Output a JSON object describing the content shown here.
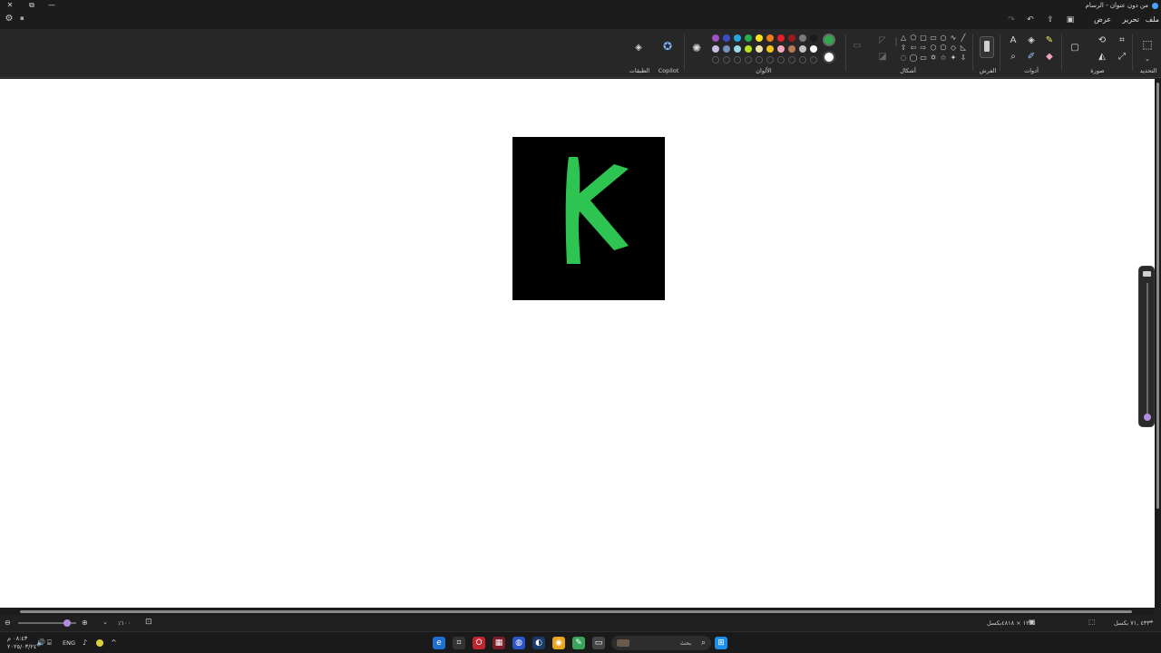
{
  "window": {
    "title": "من دون عنوان - الرسام",
    "min": "—",
    "restore": "⧉",
    "close": "✕"
  },
  "menu": {
    "file": "ملف",
    "edit": "تحرير",
    "view": "عرض"
  },
  "ribbon": {
    "groups": {
      "selection": "التحديد",
      "image": "صورة",
      "tools": "أدوات",
      "brushes": "الفرش",
      "shapes": "أشكال",
      "colors": "الألوان",
      "copilot": "Copilot",
      "layers": "الطبقات"
    },
    "active_color": "#2eaa4a",
    "secondary_color": "#ffffff",
    "palette_row1": [
      "#1a1a1a",
      "#7a7a7a",
      "#9b1b1b",
      "#e81e2a",
      "#f07d1a",
      "#f7e61c",
      "#27b04a",
      "#25a8e0",
      "#3a4fc7",
      "#a14fc1"
    ],
    "palette_row2": [
      "#ffffff",
      "#c3c3c3",
      "#b97a56",
      "#f7a9c0",
      "#f5c518",
      "#efe4b0",
      "#b5e61d",
      "#99d9ea",
      "#7092be",
      "#c8bfe7"
    ]
  },
  "canvas": {
    "letter": "K",
    "letter_color": "#2ec452",
    "background_color": "#000000"
  },
  "status": {
    "cursor_pos": "٤٣٣ ,٧١ بكسل",
    "canvas_size": "١٢٧٥ × ٤٨١٨بكسل",
    "zoom": "١٠٠٪"
  },
  "taskbar": {
    "search": "بحث",
    "lang": "ENG",
    "time": "٠٨:٤٣ م",
    "date": "٢٠٢٥/٠٣/٢٤"
  }
}
